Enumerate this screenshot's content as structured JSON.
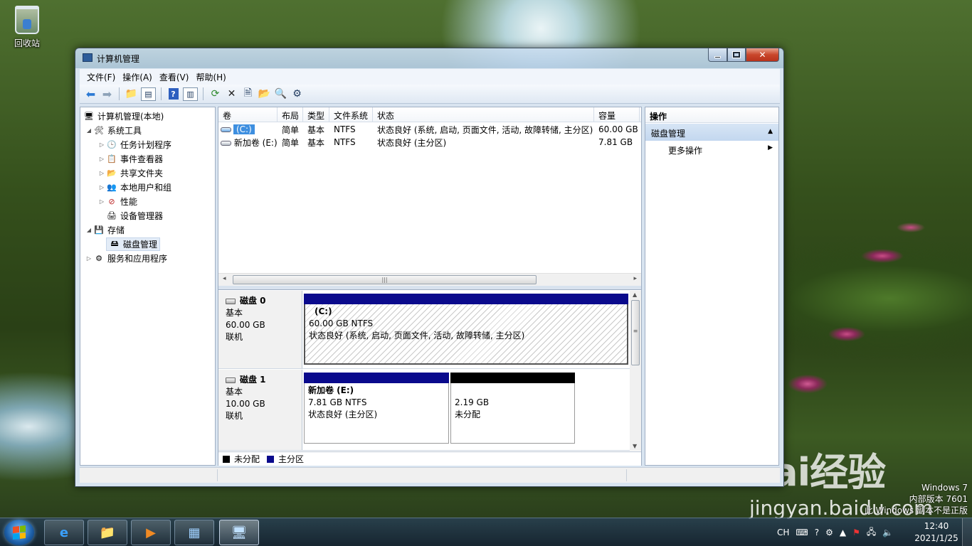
{
  "desktop": {
    "recycle_bin_label": "回收站"
  },
  "window": {
    "title": "计算机管理",
    "menu": [
      "文件(F)",
      "操作(A)",
      "查看(V)",
      "帮助(H)"
    ]
  },
  "tree": {
    "root": "计算机管理(本地)",
    "system_tools": "系统工具",
    "task_scheduler": "任务计划程序",
    "event_viewer": "事件查看器",
    "shared_folders": "共享文件夹",
    "local_users": "本地用户和组",
    "performance": "性能",
    "device_manager": "设备管理器",
    "storage": "存储",
    "disk_management": "磁盘管理",
    "services_apps": "服务和应用程序"
  },
  "volumes": {
    "columns": [
      "卷",
      "布局",
      "类型",
      "文件系统",
      "状态",
      "容量"
    ],
    "rows": [
      {
        "name": "(C:)",
        "layout": "简单",
        "type": "基本",
        "fs": "NTFS",
        "status": "状态良好 (系统, 启动, 页面文件, 活动, 故障转储, 主分区)",
        "capacity": "60.00 GB"
      },
      {
        "name": "新加卷 (E:)",
        "layout": "简单",
        "type": "基本",
        "fs": "NTFS",
        "status": "状态良好 (主分区)",
        "capacity": "7.81 GB"
      }
    ]
  },
  "disks": {
    "disk0": {
      "name": "磁盘 0",
      "kind": "基本",
      "size": "60.00 GB",
      "state": "联机",
      "partition": {
        "label": "(C:)",
        "size_fs": "60.00 GB NTFS",
        "status": "状态良好 (系统, 启动, 页面文件, 活动, 故障转储, 主分区)"
      }
    },
    "disk1": {
      "name": "磁盘 1",
      "kind": "基本",
      "size": "10.00 GB",
      "state": "联机",
      "partition": {
        "label": "新加卷  (E:)",
        "size_fs": "7.81 GB NTFS",
        "status": "状态良好 (主分区)"
      },
      "unallocated": {
        "size": "2.19 GB",
        "status": "未分配"
      }
    }
  },
  "legend": {
    "unallocated": "未分配",
    "primary": "主分区"
  },
  "colors": {
    "primary": "#0a0a8c",
    "unallocated": "#000000",
    "selected_volume": "#3e8fe0"
  },
  "actions": {
    "header": "操作",
    "group": "磁盘管理",
    "more": "更多操作"
  },
  "watermark": {
    "line1": "Windows 7",
    "line2": "内部版本 7601",
    "line3": "此 Windows 副本不是正版",
    "baidu_logo": "Bai经验",
    "baidu_site": "jingyan.baidu.com"
  },
  "taskbar": {
    "ime": "CH",
    "time": "12:40",
    "date": "2021/1/25"
  }
}
